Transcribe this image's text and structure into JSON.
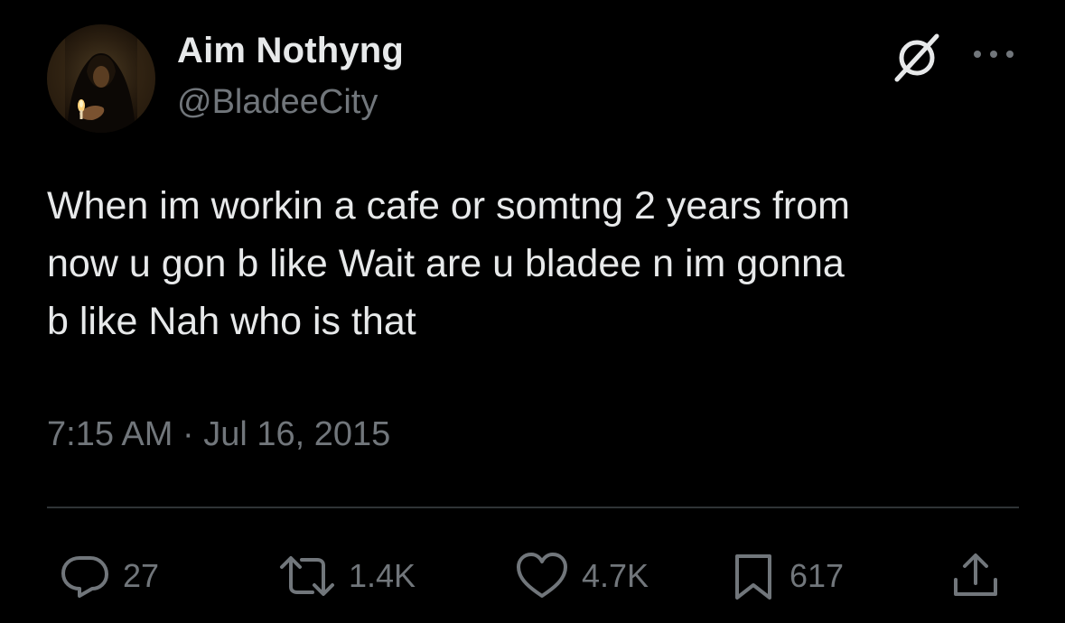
{
  "author": {
    "display_name": "Aim Nothyng",
    "handle": "@BladeeCity",
    "avatar_icon": "user-avatar-hooded-figure"
  },
  "header_actions": {
    "grok_icon": "grok-icon",
    "more_icon": "more-options-icon"
  },
  "tweet": {
    "text": "When im workin a cafe or somtng 2 years from\nnow u gon b like Wait are u bladee n im gonna\nb like Nah who is that",
    "timestamp": "7:15 AM · Jul 16, 2015"
  },
  "engagement": {
    "replies": "27",
    "reposts": "1.4K",
    "likes": "4.7K",
    "bookmarks": "617"
  },
  "colors": {
    "background": "#000000",
    "primary_text": "#e7e9ea",
    "secondary_text": "#71767b",
    "divider": "#2f3336"
  }
}
